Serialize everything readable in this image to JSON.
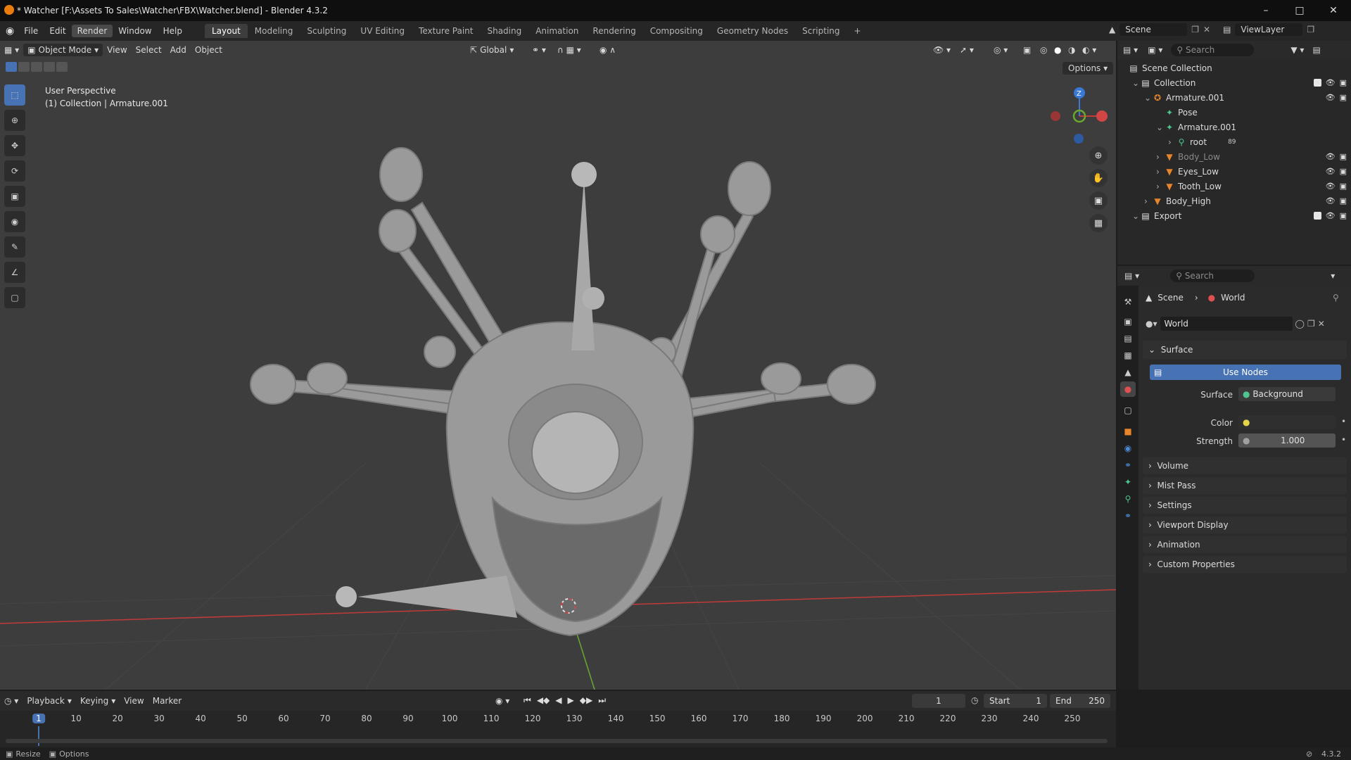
{
  "window": {
    "title": "* Watcher [F:\\Assets To Sales\\Watcher\\FBX\\Watcher.blend] - Blender 4.3.2"
  },
  "menubar": {
    "menus": [
      "File",
      "Edit",
      "Render",
      "Window",
      "Help"
    ],
    "workspaces": [
      "Layout",
      "Modeling",
      "Sculpting",
      "UV Editing",
      "Texture Paint",
      "Shading",
      "Animation",
      "Rendering",
      "Compositing",
      "Geometry Nodes",
      "Scripting"
    ],
    "active_workspace": "Layout",
    "scene": "Scene",
    "view_layer": "ViewLayer"
  },
  "viewport": {
    "mode": "Object Mode",
    "menus": [
      "View",
      "Select",
      "Add",
      "Object"
    ],
    "transform_orientation": "Global",
    "options_label": "Options",
    "overlay_line1": "User Perspective",
    "overlay_line2": "(1) Collection | Armature.001",
    "gizmo_axis": "Z"
  },
  "outliner": {
    "search_placeholder": "Search",
    "rows": [
      {
        "label": "Scene Collection",
        "depth": 0,
        "icon": "scene-collection-icon"
      },
      {
        "label": "Collection",
        "depth": 1,
        "icon": "collection-icon"
      },
      {
        "label": "Armature.001",
        "depth": 2,
        "icon": "armature-icon"
      },
      {
        "label": "Pose",
        "depth": 3,
        "icon": "pose-icon"
      },
      {
        "label": "Armature.001",
        "depth": 3,
        "icon": "armature-data-icon"
      },
      {
        "label": "root",
        "depth": 4,
        "icon": "bone-icon",
        "badge": "89"
      },
      {
        "label": "Body_Low",
        "depth": 3,
        "icon": "mesh-icon"
      },
      {
        "label": "Eyes_Low",
        "depth": 3,
        "icon": "mesh-icon"
      },
      {
        "label": "Tooth_Low",
        "depth": 3,
        "icon": "mesh-icon"
      },
      {
        "label": "Body_High",
        "depth": 2,
        "icon": "mesh-icon"
      },
      {
        "label": "Export",
        "depth": 1,
        "icon": "collection-icon"
      }
    ]
  },
  "properties": {
    "search_placeholder": "Search",
    "breadcrumb_scene": "Scene",
    "breadcrumb_world": "World",
    "world_name": "World",
    "surface_panel": "Surface",
    "use_nodes": "Use Nodes",
    "surface_label": "Surface",
    "surface_value": "Background",
    "color_label": "Color",
    "strength_label": "Strength",
    "strength_value": "1.000",
    "panels": [
      "Volume",
      "Mist Pass",
      "Settings",
      "Viewport Display",
      "Animation",
      "Custom Properties"
    ]
  },
  "timeline": {
    "menus": [
      "Playback",
      "Keying",
      "View",
      "Marker"
    ],
    "current_frame": "1",
    "start_label": "Start",
    "start_value": "1",
    "end_label": "End",
    "end_value": "250",
    "ticks": [
      "1",
      "10",
      "20",
      "30",
      "40",
      "50",
      "60",
      "70",
      "80",
      "90",
      "100",
      "110",
      "120",
      "130",
      "140",
      "150",
      "160",
      "170",
      "180",
      "190",
      "200",
      "210",
      "220",
      "230",
      "240",
      "250"
    ]
  },
  "statusbar": {
    "left1": "Resize",
    "left2": "Options",
    "version": "4.3.2"
  },
  "colors": {
    "accent": "#4772b3",
    "viewport_bg": "#3d3d3d",
    "x_axis": "#c23a3a",
    "y_axis": "#6aa82e",
    "z_axis": "#3a78d6"
  }
}
